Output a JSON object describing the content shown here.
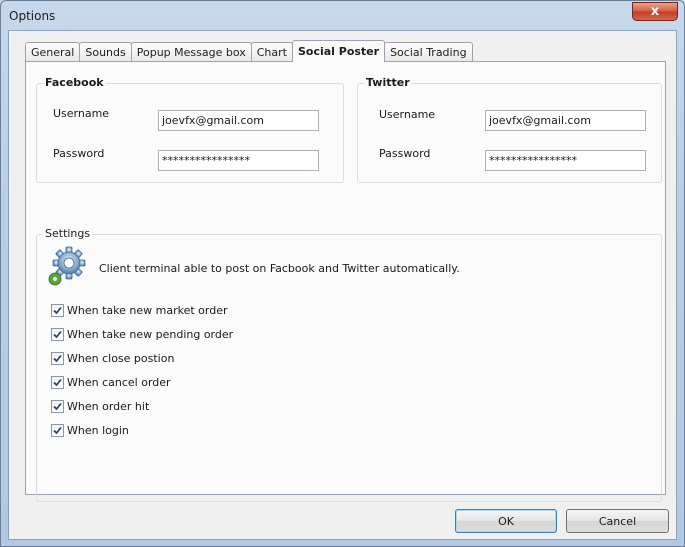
{
  "window": {
    "title": "Options",
    "close_glyph": "x"
  },
  "tabs": [
    {
      "label": "General",
      "active": false
    },
    {
      "label": "Sounds",
      "active": false
    },
    {
      "label": "Popup Message box",
      "active": false
    },
    {
      "label": "Chart",
      "active": false
    },
    {
      "label": "Social Poster",
      "active": true
    },
    {
      "label": "Social Trading",
      "active": false
    }
  ],
  "facebook": {
    "title": "Facebook",
    "username_label": "Username",
    "username_value": "joevfx@gmail.com",
    "password_label": "Password",
    "password_value": "****************"
  },
  "twitter": {
    "title": "Twitter",
    "username_label": "Username",
    "username_value": "joevfx@gmail.com",
    "password_label": "Password",
    "password_value": "****************"
  },
  "settings": {
    "title": "Settings",
    "description": "Client terminal able to post on Facbook and Twitter automatically.",
    "icon": "gear-icon",
    "options": [
      {
        "label": "When take new market order",
        "checked": true
      },
      {
        "label": "When take new pending order",
        "checked": true
      },
      {
        "label": "When close postion",
        "checked": true
      },
      {
        "label": "When cancel order",
        "checked": true
      },
      {
        "label": "When order hit",
        "checked": true
      },
      {
        "label": "When login",
        "checked": true
      }
    ]
  },
  "buttons": {
    "ok": "OK",
    "cancel": "Cancel"
  }
}
